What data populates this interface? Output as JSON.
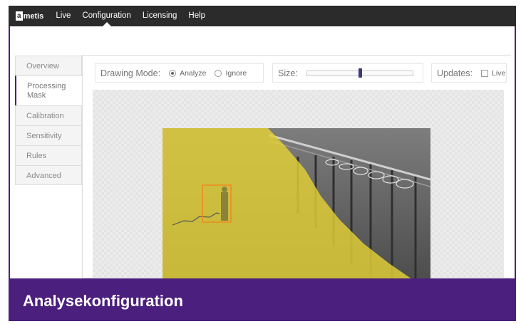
{
  "navbar": {
    "logo_mark": "a",
    "logo_text": "metis",
    "items": [
      {
        "label": "Live"
      },
      {
        "label": "Configuration"
      },
      {
        "label": "Licensing"
      },
      {
        "label": "Help"
      }
    ],
    "active_item": "Configuration"
  },
  "sidebar": {
    "tabs": [
      {
        "label": "Overview"
      },
      {
        "label": "Processing Mask"
      },
      {
        "label": "Calibration"
      },
      {
        "label": "Sensitivity"
      },
      {
        "label": "Rules"
      },
      {
        "label": "Advanced"
      }
    ],
    "active_tab": "Processing Mask"
  },
  "toolbar": {
    "drawing_mode_label": "Drawing Mode:",
    "drawing_options": [
      {
        "label": "Analyze",
        "selected": true
      },
      {
        "label": "Ignore",
        "selected": false
      }
    ],
    "size_label": "Size:",
    "size_value_fraction": 0.5,
    "updates_label": "Updates:",
    "live_label": "Live",
    "live_checked": false
  },
  "banner": {
    "title": "Analysekonfiguration"
  },
  "colors": {
    "brand_purple": "#4b1f7e",
    "navbar_bg": "#2b2b2b",
    "mask_yellow": "#e3d136",
    "bbox_orange": "#f08a1c",
    "slider_thumb": "#3e3a7a"
  }
}
